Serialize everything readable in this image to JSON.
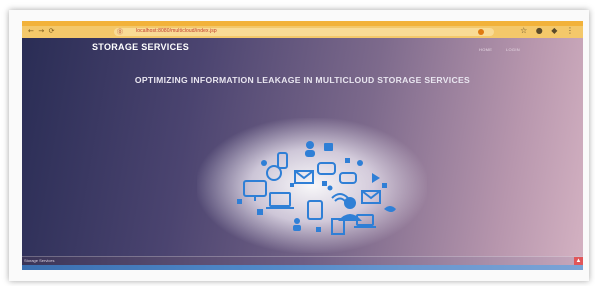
{
  "navbar": {
    "brand": "STORAGE SERVICES",
    "links": [
      "HOME",
      "LOGIN"
    ]
  },
  "browser": {
    "url": "localhost:8080/multicloud/index.jsp"
  },
  "hero": {
    "headline": "OPTIMIZING INFORMATION LEAKAGE IN MULTICLOUD STORAGE SERVICES"
  },
  "footer": {
    "text": "Storage Services",
    "up_icon": "arrow-up-icon"
  },
  "colors": {
    "tab_strip": "#f2b23a",
    "page_gradient_start": "#2a2d55",
    "page_gradient_end": "#d4b2c2",
    "cloud_icons": "#2f7fd6",
    "up_button": "#e0565a"
  }
}
